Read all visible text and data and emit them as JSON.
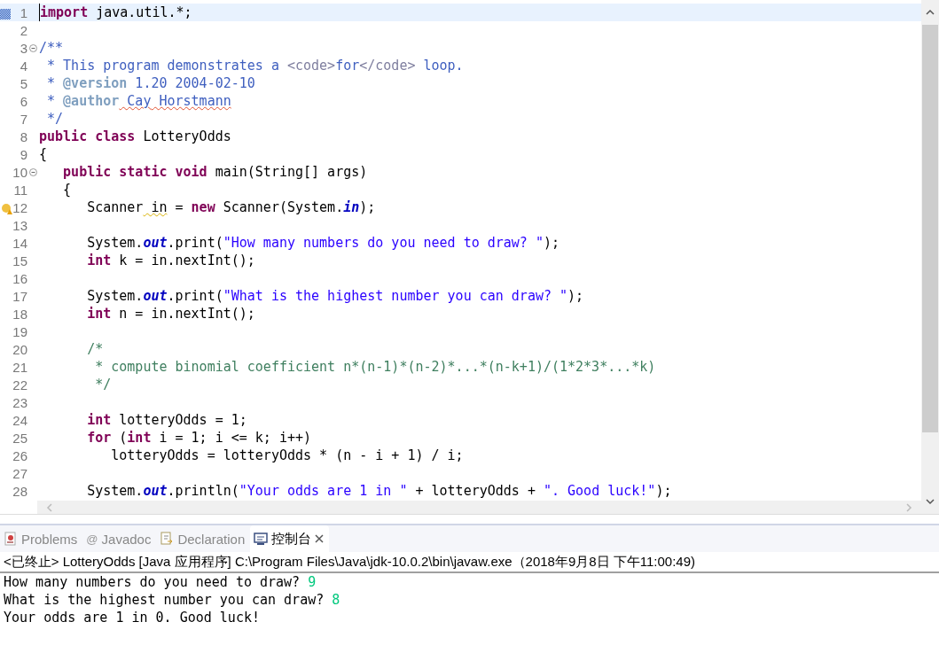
{
  "editor": {
    "lines": [
      {
        "number": "1",
        "current": true,
        "fold": false,
        "tokens": [
          {
            "kind": "kw",
            "text": "import"
          },
          {
            "kind": "plain",
            "text": " java.util.*;"
          }
        ]
      },
      {
        "number": "2",
        "current": false,
        "fold": false
      },
      {
        "number": "3",
        "current": false,
        "fold": true,
        "tokens": [
          {
            "kind": "doc",
            "text": "/**"
          }
        ]
      },
      {
        "number": "4",
        "current": false,
        "fold": false,
        "tokens": [
          {
            "kind": "doc",
            "text": " * This program demonstrates a "
          },
          {
            "kind": "html",
            "text": "<code>"
          },
          {
            "kind": "doc",
            "text": "for"
          },
          {
            "kind": "html",
            "text": "</code>"
          },
          {
            "kind": "doc",
            "text": " loop."
          }
        ]
      },
      {
        "number": "5",
        "current": false,
        "fold": false,
        "tokens": [
          {
            "kind": "doc",
            "text": " * "
          },
          {
            "kind": "doctag",
            "text": "@version"
          },
          {
            "kind": "doc",
            "text": " 1.20 2004-02-10"
          }
        ]
      },
      {
        "number": "6",
        "current": false,
        "fold": false,
        "tokens": [
          {
            "kind": "doc",
            "text": " * "
          },
          {
            "kind": "doctag",
            "text": "@author"
          },
          {
            "kind": "spell",
            "text": " Cay"
          },
          {
            "kind": "spell",
            "text": " Horstmann"
          }
        ]
      },
      {
        "number": "7",
        "current": false,
        "fold": false,
        "tokens": [
          {
            "kind": "doc",
            "text": " */"
          }
        ]
      },
      {
        "number": "8",
        "current": false,
        "fold": false,
        "tokens": [
          {
            "kind": "kw",
            "text": "public class"
          },
          {
            "kind": "plain",
            "text": " LotteryOdds"
          }
        ]
      },
      {
        "number": "9",
        "current": false,
        "fold": false,
        "tokens": [
          {
            "kind": "plain",
            "text": "{"
          }
        ]
      },
      {
        "number": "10",
        "current": false,
        "fold": true,
        "tokens": [
          {
            "kind": "kw",
            "text": "   public static void"
          },
          {
            "kind": "plain",
            "text": " main(String[] args)"
          }
        ]
      },
      {
        "number": "11",
        "current": false,
        "fold": false,
        "tokens": [
          {
            "kind": "plain",
            "text": "   {"
          }
        ]
      },
      {
        "number": "12",
        "current": false,
        "fold": false,
        "warning": true,
        "tokens": [
          {
            "kind": "plain",
            "text": "      Scanner"
          },
          {
            "kind": "warn",
            "text": " in"
          },
          {
            "kind": "plain",
            "text": " = "
          },
          {
            "kind": "kw",
            "text": "new"
          },
          {
            "kind": "plain",
            "text": " Scanner(System."
          },
          {
            "kind": "static",
            "text": "in"
          },
          {
            "kind": "plain",
            "text": ");"
          }
        ]
      },
      {
        "number": "13",
        "current": false,
        "fold": false
      },
      {
        "number": "14",
        "current": false,
        "fold": false,
        "tokens": [
          {
            "kind": "plain",
            "text": "      System."
          },
          {
            "kind": "static",
            "text": "out"
          },
          {
            "kind": "plain",
            "text": ".print("
          },
          {
            "kind": "string",
            "text": "\"How many numbers do you need to draw? \""
          },
          {
            "kind": "plain",
            "text": ");"
          }
        ]
      },
      {
        "number": "15",
        "current": false,
        "fold": false,
        "tokens": [
          {
            "kind": "kw",
            "text": "      int"
          },
          {
            "kind": "plain",
            "text": " k = in.nextInt();"
          }
        ]
      },
      {
        "number": "16",
        "current": false,
        "fold": false
      },
      {
        "number": "17",
        "current": false,
        "fold": false,
        "tokens": [
          {
            "kind": "plain",
            "text": "      System."
          },
          {
            "kind": "static",
            "text": "out"
          },
          {
            "kind": "plain",
            "text": ".print("
          },
          {
            "kind": "string",
            "text": "\"What is the highest number you can draw? \""
          },
          {
            "kind": "plain",
            "text": ");"
          }
        ]
      },
      {
        "number": "18",
        "current": false,
        "fold": false,
        "tokens": [
          {
            "kind": "kw",
            "text": "      int"
          },
          {
            "kind": "plain",
            "text": " n = in.nextInt();"
          }
        ]
      },
      {
        "number": "19",
        "current": false,
        "fold": false
      },
      {
        "number": "20",
        "current": false,
        "fold": false,
        "tokens": [
          {
            "kind": "comment",
            "text": "      /*"
          }
        ]
      },
      {
        "number": "21",
        "current": false,
        "fold": false,
        "tokens": [
          {
            "kind": "comment",
            "text": "       * compute binomial coefficient n*(n-1)*(n-2)*...*(n-k+1)/(1*2*3*...*k)"
          }
        ]
      },
      {
        "number": "22",
        "current": false,
        "fold": false,
        "tokens": [
          {
            "kind": "comment",
            "text": "       */"
          }
        ]
      },
      {
        "number": "23",
        "current": false,
        "fold": false
      },
      {
        "number": "24",
        "current": false,
        "fold": false,
        "tokens": [
          {
            "kind": "kw",
            "text": "      int"
          },
          {
            "kind": "plain",
            "text": " lotteryOdds = 1;"
          }
        ]
      },
      {
        "number": "25",
        "current": false,
        "fold": false,
        "tokens": [
          {
            "kind": "kw",
            "text": "      for"
          },
          {
            "kind": "plain",
            "text": " ("
          },
          {
            "kind": "kw",
            "text": "int"
          },
          {
            "kind": "plain",
            "text": " i = 1; i <= k; i++)"
          }
        ]
      },
      {
        "number": "26",
        "current": false,
        "fold": false,
        "tokens": [
          {
            "kind": "plain",
            "text": "         lotteryOdds = lotteryOdds * (n - i + 1) / i;"
          }
        ]
      },
      {
        "number": "27",
        "current": false,
        "fold": false
      },
      {
        "number": "28",
        "current": false,
        "fold": false,
        "tokens": [
          {
            "kind": "plain",
            "text": "      System."
          },
          {
            "kind": "static",
            "text": "out"
          },
          {
            "kind": "plain",
            "text": ".println("
          },
          {
            "kind": "string",
            "text": "\"Your odds are 1 in \""
          },
          {
            "kind": "plain",
            "text": " + lotteryOdds + "
          },
          {
            "kind": "string",
            "text": "\". Good luck!\""
          },
          {
            "kind": "plain",
            "text": ");"
          }
        ]
      }
    ]
  },
  "views": {
    "tabs": [
      {
        "kind": "problems",
        "label": "Problems",
        "selected": false,
        "closable": false
      },
      {
        "kind": "javadoc",
        "label": "@",
        "text": "Javadoc",
        "selected": false,
        "closable": false
      },
      {
        "kind": "declaration",
        "label": "Declaration",
        "selected": false,
        "closable": false
      },
      {
        "kind": "console",
        "label": "控制台",
        "selected": true,
        "closable": true
      }
    ]
  },
  "console": {
    "header": "<已终止> LotteryOdds [Java 应用程序] C:\\Program Files\\Java\\jdk-10.0.2\\bin\\javaw.exe（2018年9月8日 下午11:00:49)",
    "lines": [
      {
        "output": "How many numbers do you need to draw? ",
        "input": "9"
      },
      {
        "output": "What is the highest number you can draw? ",
        "input": "8"
      },
      {
        "output": "Your odds are 1 in 0. Good luck!"
      }
    ]
  }
}
